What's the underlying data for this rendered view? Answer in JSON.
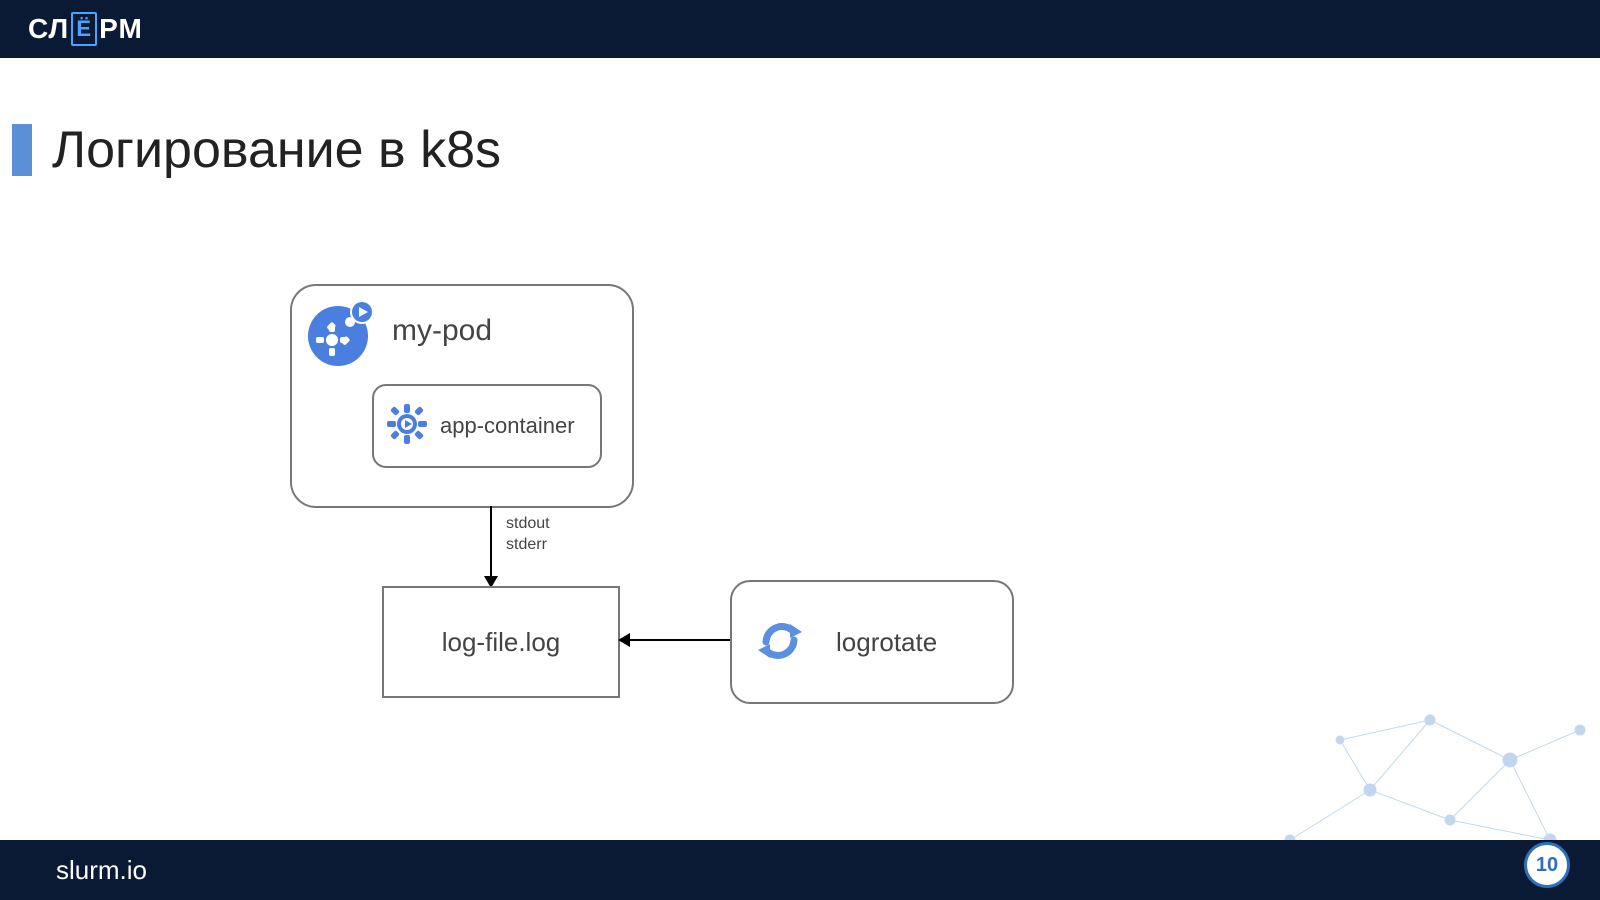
{
  "header": {
    "logo_left": "СЛ",
    "logo_yo": "Ё",
    "logo_right": "РМ"
  },
  "slide": {
    "title": "Логирование в k8s",
    "page_number": "10"
  },
  "diagram": {
    "pod_label": "my-pod",
    "container_label": "app-container",
    "edge1_line1": "stdout",
    "edge1_line2": "stderr",
    "logfile_label": "log-file.log",
    "logrotate_label": "logrotate"
  },
  "footer": {
    "url": "slurm.io"
  }
}
